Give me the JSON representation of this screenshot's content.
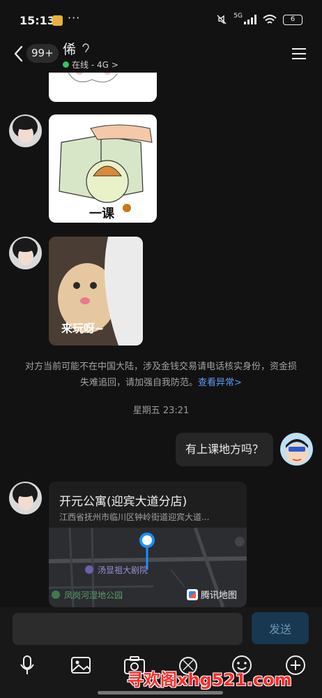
{
  "status_bar": {
    "time": "15:13",
    "dots": "···",
    "network": "5G",
    "battery": "6"
  },
  "header": {
    "back_badge": "99+",
    "contact_name": "俙",
    "online_status": "在线 - 4G",
    "chevron": ">"
  },
  "messages": {
    "sticker1_caption": "一课",
    "sticker2_caption": "来玩呀~",
    "system_notice": "对方当前可能不在中国大陆，涉及金钱交易请电话核实身份，资金损失难追回，请加强自我防范。",
    "system_notice_link": "查看异常>",
    "time_separator": "星期五 23:21",
    "outgoing_text": "有上课地方吗？"
  },
  "location_card": {
    "title": "开元公寓(迎宾大道分店)",
    "address": "江西省抚州市临川区钟岭街道迎宾大道...",
    "poi_theater": "汤显祖大剧院",
    "poi_park": "凤岗河湿地公园",
    "map_brand": "腾讯地图"
  },
  "input_bar": {
    "send_label": "发送",
    "placeholder": ""
  },
  "watermark": "寻欢阁xhg521.com",
  "colors": {
    "accent": "#5b9cf3",
    "online": "#34c659",
    "send_bg": "#18384f",
    "pin": "#1a90ff"
  }
}
